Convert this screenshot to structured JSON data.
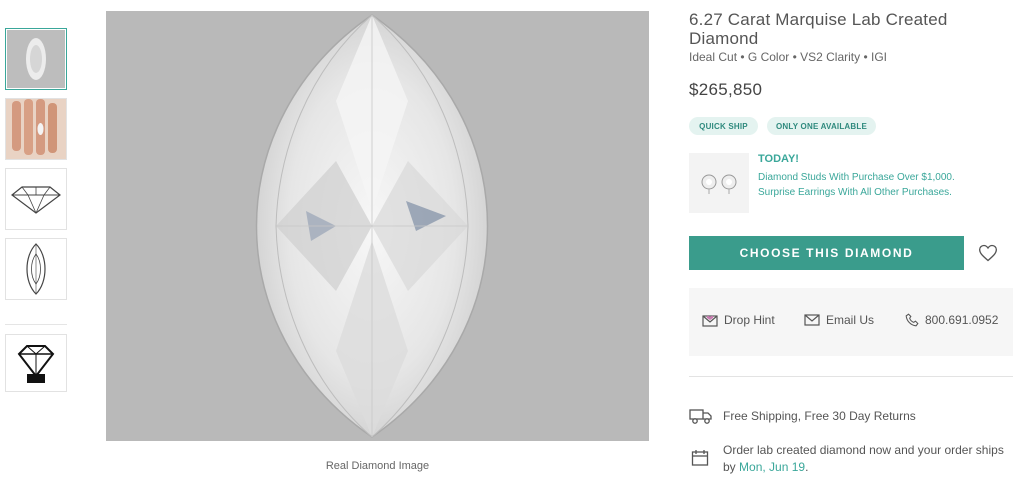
{
  "thumbnails": [
    {
      "name": "thumb-diamond-photo",
      "icon": "marquise-photo"
    },
    {
      "name": "thumb-hand-view",
      "icon": "hand-photo"
    },
    {
      "name": "thumb-side-profile",
      "icon": "side-profile-outline"
    },
    {
      "name": "thumb-top-outline",
      "icon": "marquise-outline"
    },
    {
      "name": "thumb-igi-certificate",
      "icon": "igi-logo"
    }
  ],
  "main_image": {
    "caption": "Real Diamond Image",
    "background": "#b9b9b9"
  },
  "product": {
    "title": "6.27 Carat Marquise Lab Created Diamond",
    "specs": "Ideal Cut • G Color • VS2 Clarity • IGI",
    "price": "$265,850",
    "badges": [
      "QUICK SHIP",
      "ONLY ONE AVAILABLE"
    ]
  },
  "promo": {
    "heading": "TODAY!",
    "text": "Diamond Studs With Purchase Over $1,000. Surprise Earrings With All Other Purchases.",
    "image_icon": "stud-earrings"
  },
  "actions": {
    "choose_label": "CHOOSE THIS DIAMOND",
    "wishlist_icon": "heart-icon"
  },
  "contact": {
    "drop_hint": "Drop Hint",
    "email_us": "Email Us",
    "phone": "800.691.0952"
  },
  "shipping": {
    "free_shipping": "Free Shipping, Free 30 Day Returns",
    "order_text": "Order lab created diamond now and your order ships by",
    "order_date": "Mon, Jun 19",
    "order_suffix": "."
  },
  "colors": {
    "accent": "#3a9c8c",
    "badge_bg": "#e4f3f0",
    "badge_text": "#2f8a7e"
  }
}
